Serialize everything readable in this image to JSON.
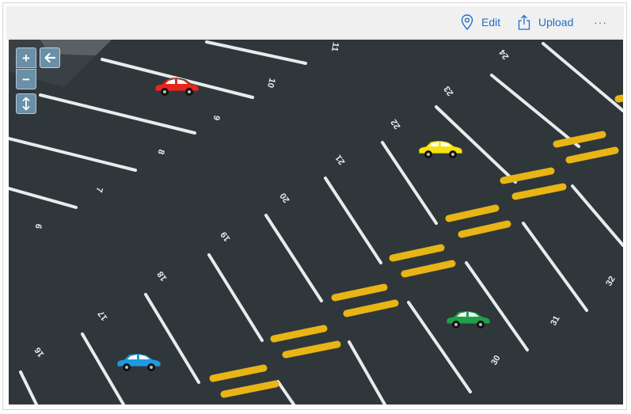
{
  "toolbar": {
    "edit_label": "Edit",
    "upload_label": "Upload",
    "more_label": "···"
  },
  "map": {
    "controls": {
      "zoom_in": "+",
      "zoom_out": "−"
    },
    "bay_numbers": [
      "11",
      "10",
      "9",
      "8",
      "7",
      "6",
      "24",
      "23",
      "22",
      "21",
      "20",
      "19",
      "18",
      "17",
      "16",
      "32",
      "31",
      "30"
    ],
    "cars": [
      {
        "name": "red",
        "color": "#e8241e"
      },
      {
        "name": "yellow",
        "color": "#f5e310"
      },
      {
        "name": "green",
        "color": "#1fa14a"
      },
      {
        "name": "blue",
        "color": "#1f9ae0"
      }
    ]
  }
}
